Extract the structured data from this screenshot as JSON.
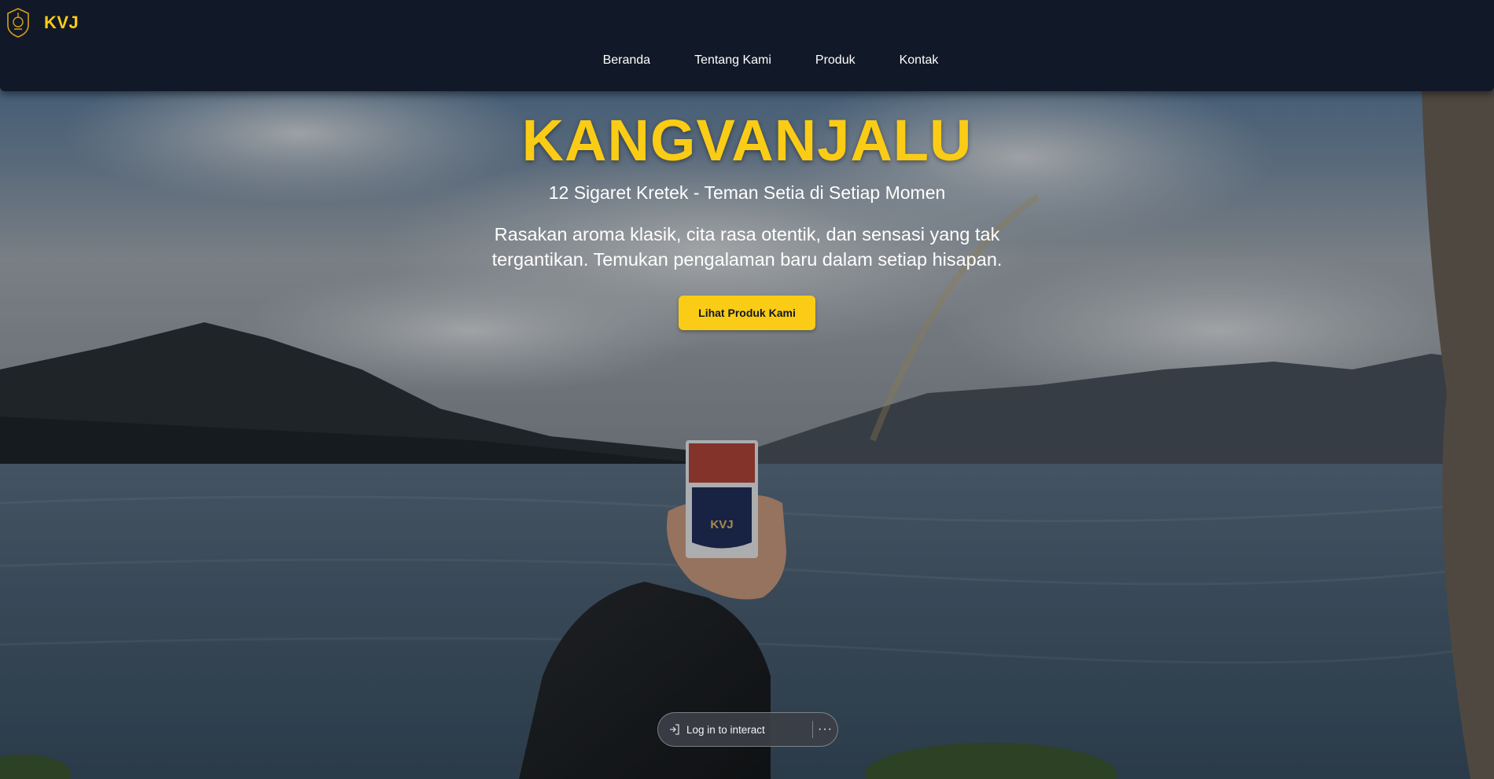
{
  "header": {
    "brand_name": "KVJ",
    "nav": [
      {
        "label": "Beranda"
      },
      {
        "label": "Tentang Kami"
      },
      {
        "label": "Produk"
      },
      {
        "label": "Kontak"
      }
    ]
  },
  "hero": {
    "title": "KANGVANJALU",
    "subtitle": "12 Sigaret Kretek - Teman Setia di Setiap Momen",
    "description": "Rasakan aroma klasik, cita rasa otentik, dan sensasi yang tak tergantikan. Temukan pengalaman baru dalam setiap hisapan.",
    "cta_label": "Lihat Produk Kami",
    "pack_label": "KVJ"
  },
  "login_pill": {
    "login_label": "Log in to interact",
    "more_label": "···"
  },
  "colors": {
    "accent": "#facc15",
    "header_bg": "#111827"
  },
  "icons": {
    "brand": "emblem-logo-icon",
    "login": "login-arrow-icon",
    "more": "more-dots-icon"
  }
}
